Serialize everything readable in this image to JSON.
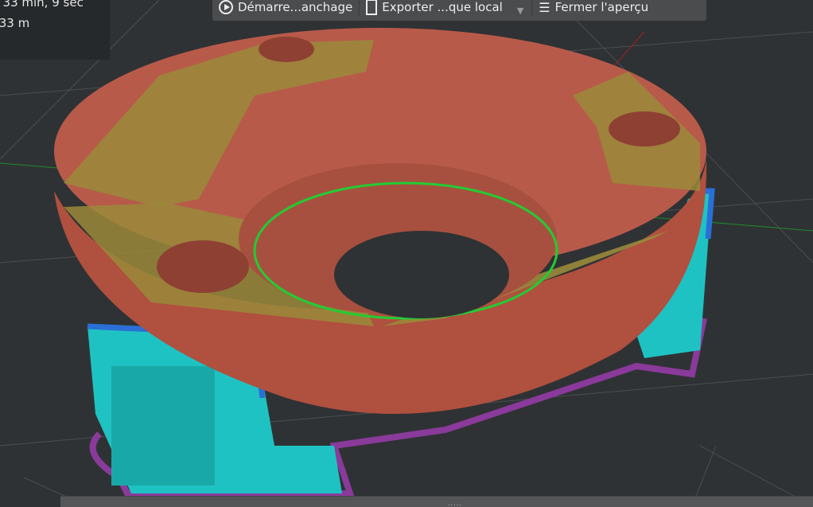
{
  "info": {
    "print_time": ", 33 min, 9 sec",
    "filament_length": ".33 m"
  },
  "toolbar": {
    "start_slicing_label": "Démarre...anchage",
    "export_label": "Exporter ...que local",
    "close_preview_label": "Fermer l'aperçu"
  },
  "bottombar": {
    "grip": "....."
  },
  "colors": {
    "perimeter": "#b85a4a",
    "infill": "#9a8a3a",
    "support": "#1fc2c2",
    "support_interface": "#2a6fd6",
    "skirt": "#8a3a9a",
    "bridge": "#22cc33"
  }
}
